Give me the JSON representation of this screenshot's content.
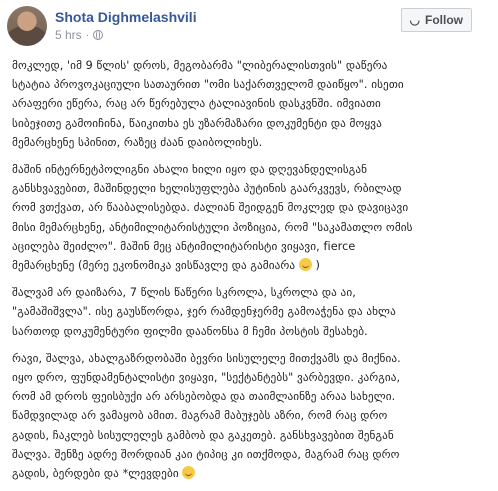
{
  "post": {
    "author": "Shota Dighmelashvili",
    "timestamp": "5 hrs",
    "separator": "·",
    "privacy_icon": "globe-icon",
    "follow_label": "Follow",
    "follow_icon": "rss-icon",
    "paragraphs": [
      {
        "lines": [
          "მოკლედ, 'იმ 9 წლის' დროს, მეგობარმა \"ლიბერალისთვის\" დაწერა",
          "სტატია პროვოკაციული სათაურით \"ომი საქართველომ დაიწყო\". ისეთი",
          "არაფერი ეწერა, რაც არ წერებულა ტალიავინის დასკვნში. იმვიათი",
          "სიბეჯითე გამოიჩინა, წაიკითხა ეს უზარმაზარი დოკუმენტი და მოყვა",
          "მემარცხენე სპინით, რაზეც ძაან დაიბოლიხეს."
        ]
      },
      {
        "lines": [
          "მაშინ ინტერნეტპოლიგნი ახალი ხილი იყო და დღევანდელისგან",
          "განსხვავებით, მაშინდელი ხელისუფლება პუტინის გაარკვევს, რბილად",
          "რომ ვთქვათ, არ წააბალისებდა. ძალიან შეიდგენ მოკლედ და დავიცავი",
          "მისი მემარცხენე, ანტიმილიტარისტული პოზიცია, რომ \"საკამათლო ომის",
          "აცილება შეიძლო\". მაშინ მეც ანტიმილიტარისტი ვიყავი, fierce",
          "მემარცხენე (მერე ეკონომიკა ვისწავლე და გამიარა "
        ],
        "trail_emoji": "smile-emoji",
        "trail_text": " )"
      },
      {
        "lines": [
          "შალვამ არ დაიზარა, 7 წლის წაწერი სკროლა, სკროლა და აი,",
          "\"გამაშიშვლა\". ისე გაუსწორდა, ჯერ რამდენჯერმე გამოაჭენა და ახლა",
          "სართოდ დოკუმენტური ფილმი დაანონსა მ ჩემი პოსტის შესახებ."
        ]
      },
      {
        "lines": [
          "რავი, შალვა, ახალგაზრდობაში ბევრი სისულელე მითქვამს და მიქნია.",
          "იყო დრო, ფუნდამენტალისტი ვიყავი, \"სექტანტებს\" ვარბევდი. კარგია,",
          "რომ ამ დროს ფეისბუქი არ არსებობდა და თაიმლაინზე არაა სახელი.",
          "წამდვილად არ ვამაყობ ამით. მაგრამ მაბუჯებს აზრი, რომ რაც დრო",
          "გადის, ჩაკლებ სისულელეს გამბობ და გაკეთებ. განსხვავებით შენგან",
          "შალვა. შენზე ადრე შორდიან კაი ტიპიც კი ითქმოდა, მაგრამ რაც დრო",
          "გადის, ბერდები და *ლევდები "
        ],
        "trail_emoji": "smile-emoji",
        "trail_text": ""
      }
    ]
  }
}
